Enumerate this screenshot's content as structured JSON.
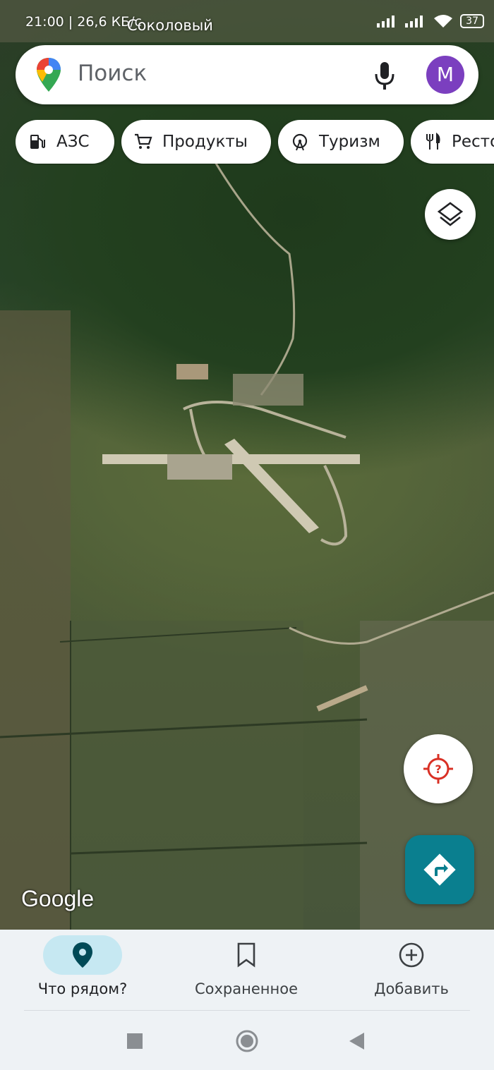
{
  "status_bar": {
    "time": "21:00 | 26,6 КБ/с",
    "battery": "37"
  },
  "map": {
    "place_label": "Соколовый",
    "watermark": "Google"
  },
  "search": {
    "placeholder": "Поиск",
    "avatar_letter": "M"
  },
  "chips": [
    {
      "label": "АЗС",
      "icon": "gas-station-icon"
    },
    {
      "label": "Продукты",
      "icon": "shopping-cart-icon"
    },
    {
      "label": "Туризм",
      "icon": "ferris-wheel-icon"
    },
    {
      "label": "Рестораны",
      "icon": "restaurant-icon"
    }
  ],
  "bottom_nav": {
    "items": [
      {
        "label": "Что рядом?",
        "icon": "location-pin-icon",
        "active": true
      },
      {
        "label": "Сохраненное",
        "icon": "bookmark-icon",
        "active": false
      },
      {
        "label": "Добавить",
        "icon": "add-circle-icon",
        "active": false
      }
    ]
  },
  "colors": {
    "accent": "#0a7f8f",
    "active_pill": "#c6e8f2",
    "avatar": "#7b3fbf",
    "locate": "#d93025"
  }
}
